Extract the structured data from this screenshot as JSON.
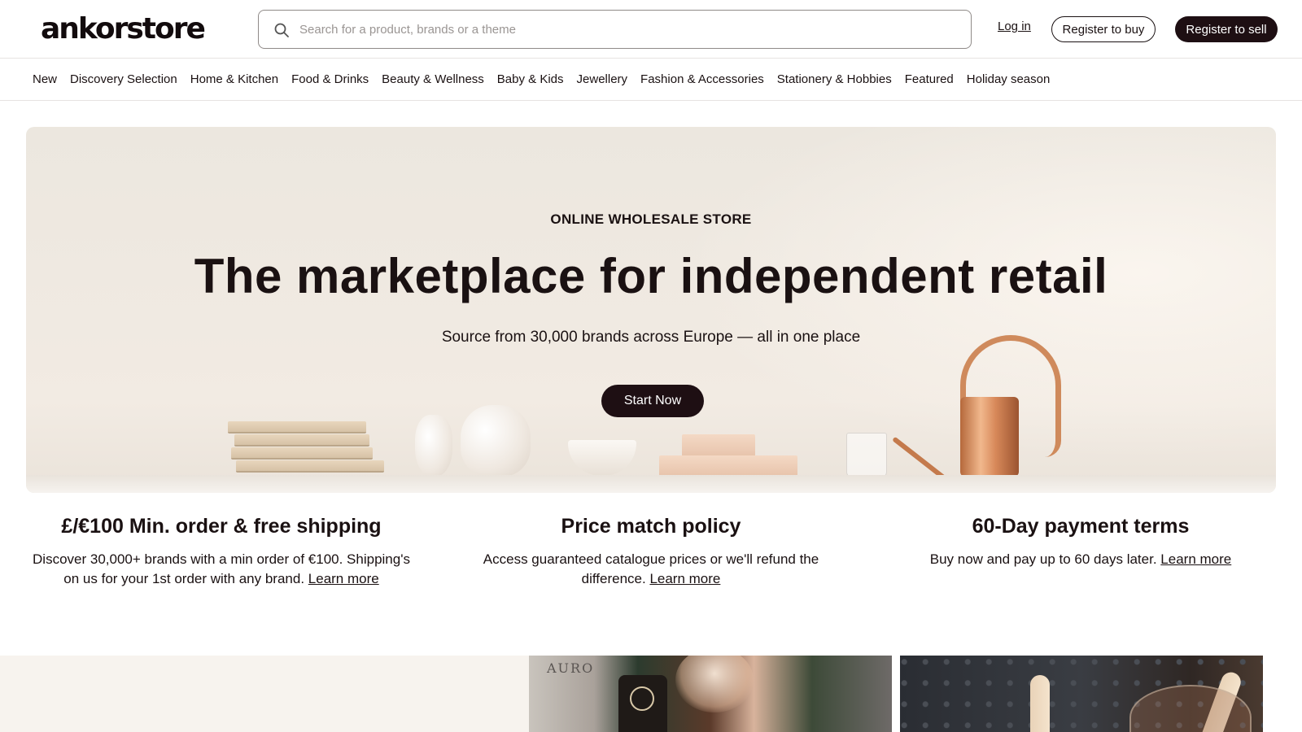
{
  "header": {
    "logo": "ankorstore",
    "search_placeholder": "Search for a product, brands or a theme",
    "login_label": "Log in",
    "register_buy_label": "Register to buy",
    "register_sell_label": "Register to sell"
  },
  "nav": {
    "items": [
      "New",
      "Discovery Selection",
      "Home & Kitchen",
      "Food & Drinks",
      "Beauty & Wellness",
      "Baby & Kids",
      "Jewellery",
      "Fashion & Accessories",
      "Stationery & Hobbies",
      "Featured",
      "Holiday season"
    ]
  },
  "hero": {
    "kicker": "ONLINE WHOLESALE STORE",
    "headline": "The marketplace for independent retail",
    "subheadline": "Source from 30,000 brands across Europe — all in one place",
    "cta_label": "Start Now"
  },
  "features": [
    {
      "title": "£/€100 Min. order & free shipping",
      "text": "Discover 30,000+ brands with a min order of €100. Shipping's on us for your 1st order with any brand.",
      "link": "Learn more"
    },
    {
      "title": "Price match policy",
      "text": "Access guaranteed catalogue prices or we'll refund the difference.",
      "link": "Learn more"
    },
    {
      "title": "60-Day payment terms",
      "text": "Buy now and pay up to 60 days later.",
      "link": "Learn more"
    }
  ],
  "strip": {
    "photo1_label": "AURO"
  },
  "colors": {
    "primary_dark": "#1e0f13",
    "hero_bg": "#efe9e1",
    "strip_bg": "#f7f3ee"
  }
}
